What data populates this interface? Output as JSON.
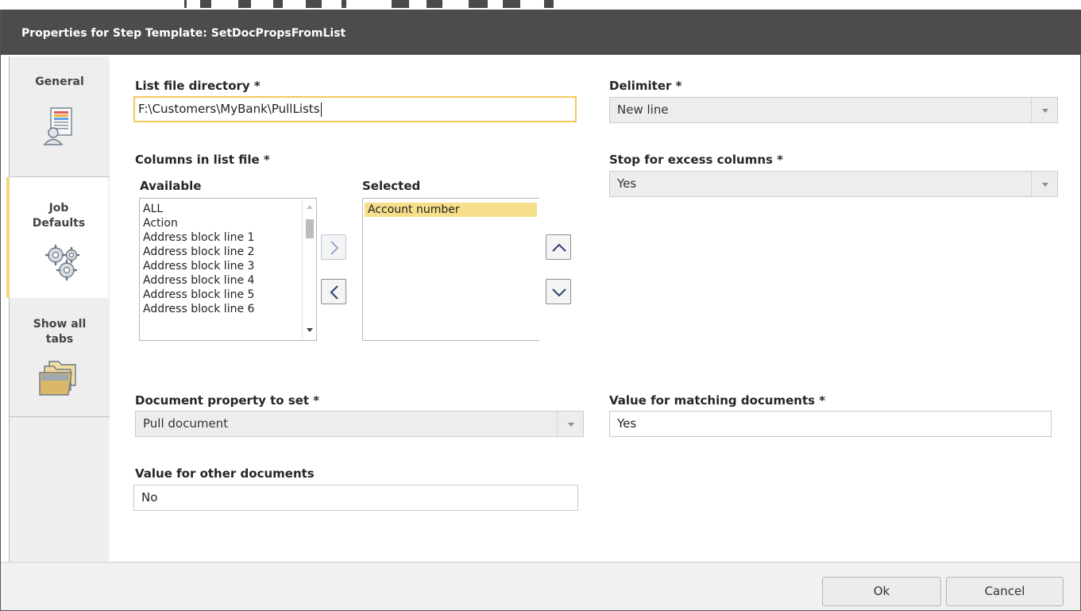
{
  "dialog": {
    "title": "Properties for Step Template: SetDocPropsFromList"
  },
  "tabs": [
    {
      "label": "General",
      "icon": "document-user-icon"
    },
    {
      "label": "Job Defaults",
      "icon": "gears-icon"
    },
    {
      "label": "Show all tabs",
      "icon": "folders-icon"
    }
  ],
  "tab_labels": {
    "general": "General",
    "job_line1": "Job",
    "job_line2": "Defaults",
    "show_line1": "Show all",
    "show_line2": "tabs"
  },
  "form": {
    "list_dir_label": "List file directory *",
    "list_dir_value": "F:\\Customers\\MyBank\\PullLists",
    "delimiter_label": "Delimiter *",
    "delimiter_value": "New line",
    "columns_label": "Columns in list file *",
    "available_label": "Available",
    "selected_label": "Selected",
    "available_items": [
      "ALL",
      "Action",
      "Address block line 1",
      "Address block line 2",
      "Address block line 3",
      "Address block line 4",
      "Address block line 5",
      "Address block line 6"
    ],
    "selected_items": [
      "Account number"
    ],
    "stop_excess_label": "Stop for excess columns *",
    "stop_excess_value": "Yes",
    "doc_prop_label": "Document property to set *",
    "doc_prop_value": "Pull document",
    "match_value_label": "Value for matching documents *",
    "match_value": "Yes",
    "other_value_label": "Value for other documents",
    "other_value": "No"
  },
  "buttons": {
    "ok": "Ok",
    "cancel": "Cancel"
  },
  "colors": {
    "titlebar": "#4c4c4c",
    "accent": "#f2c95c",
    "selection": "#f6de8a"
  }
}
